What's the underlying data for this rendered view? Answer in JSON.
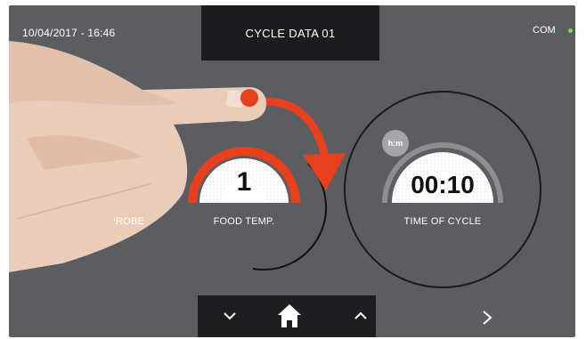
{
  "header": {
    "datetime": "10/04/2017 - 16:46",
    "title": "CYCLE DATA 01",
    "status_label": "COM",
    "status_color": "#7ed957"
  },
  "dials": [
    {
      "label": "PROBE",
      "value": ""
    },
    {
      "label": "FOOD TEMP.",
      "value": "1"
    },
    {
      "label": "TIME OF CYCLE",
      "value": "00:10",
      "unit_badge": "h:m"
    }
  ],
  "colors": {
    "panel": "#5c5d60",
    "accent": "#e8401c",
    "dial_face": "#ffffff",
    "bar": "#1e1e20"
  },
  "icons": {
    "nav_down": "chevron-down-icon",
    "nav_home": "home-icon",
    "nav_up": "chevron-up-icon",
    "next": "chevron-right-icon",
    "swipe": "rotate-arrow-icon"
  }
}
